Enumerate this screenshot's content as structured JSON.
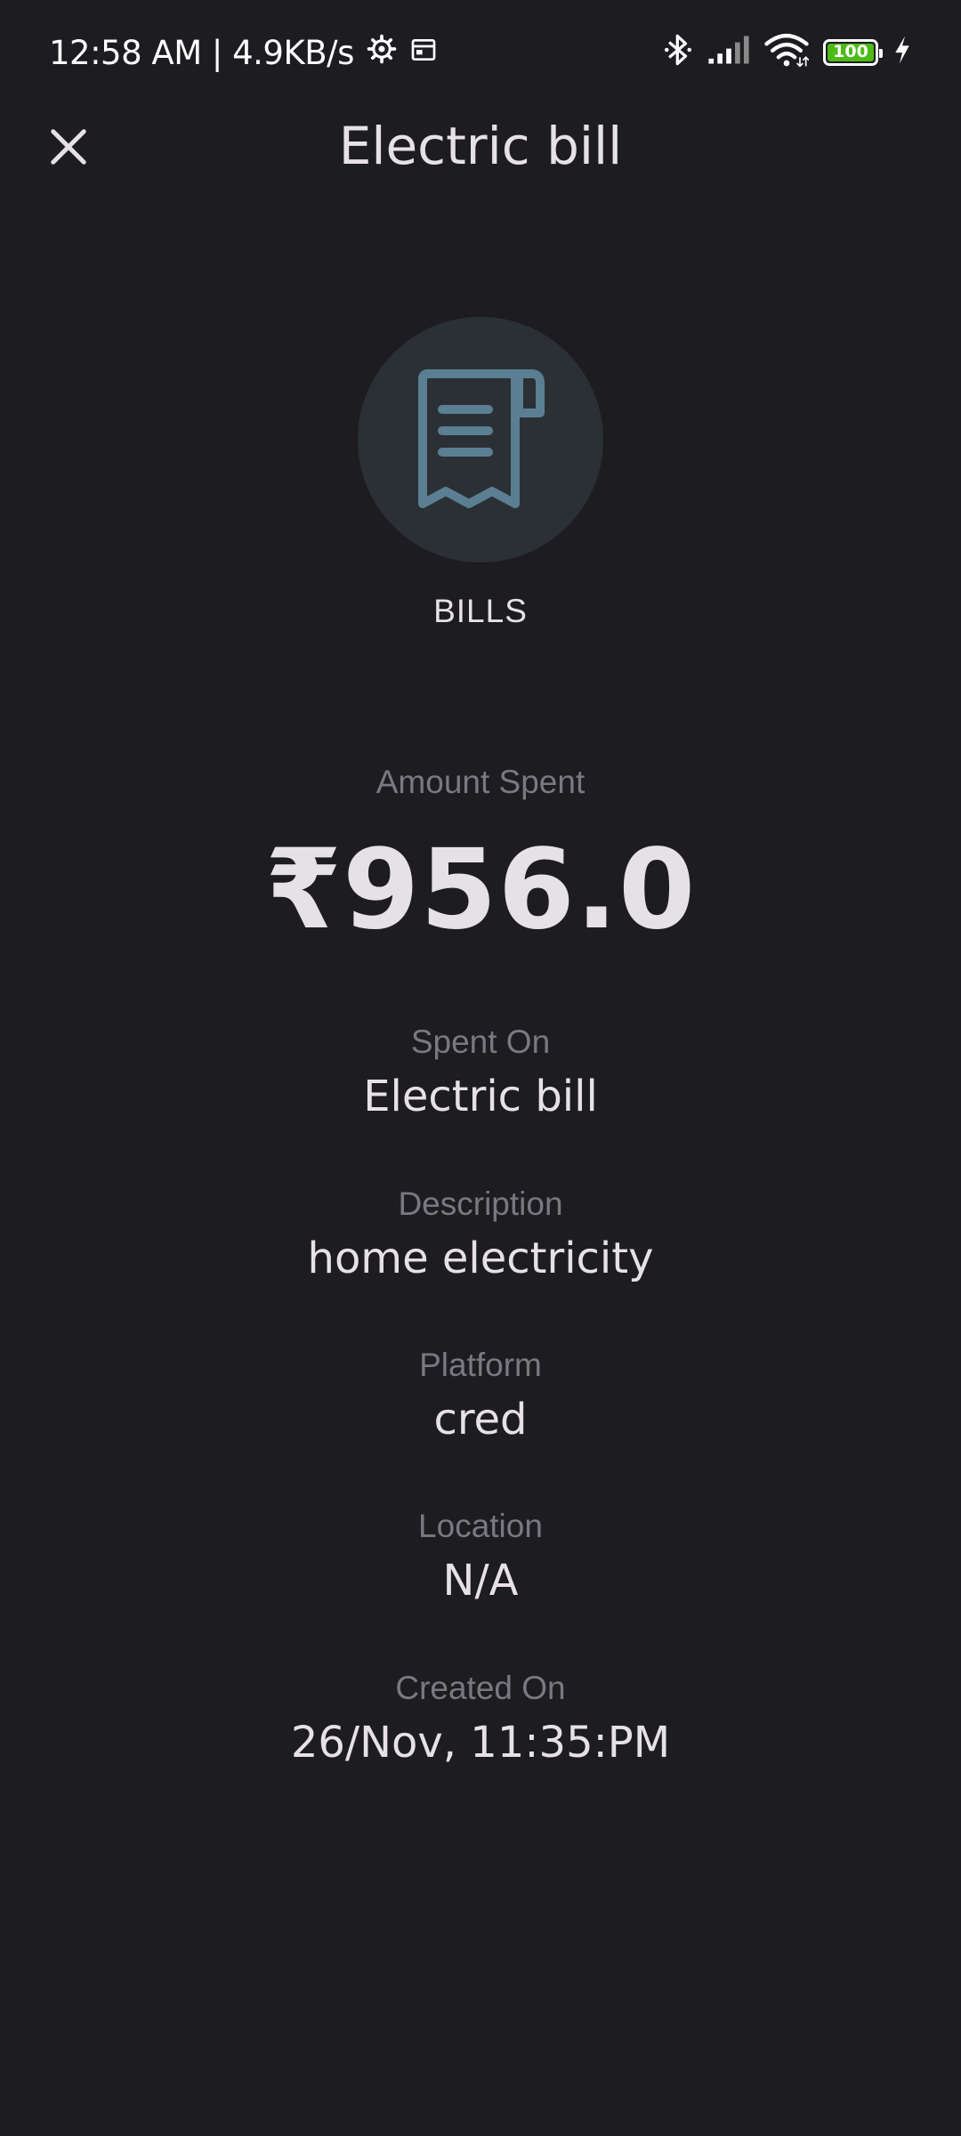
{
  "status_bar": {
    "time_speed": "12:58 AM | 4.9KB/s",
    "battery_level": "100",
    "battery_color": "#4cbb17"
  },
  "app_bar": {
    "close_icon": "close-icon",
    "title": "Electric bill"
  },
  "category": {
    "icon": "receipt-icon",
    "icon_color": "#5b7f92",
    "label": "BILLS"
  },
  "amount": {
    "label": "Amount Spent",
    "value": "₹956.0"
  },
  "details": [
    {
      "label": "Spent On",
      "value": "Electric bill"
    },
    {
      "label": "Description",
      "value": "home electricity"
    },
    {
      "label": "Platform",
      "value": "cred"
    },
    {
      "label": "Location",
      "value": "N/A"
    },
    {
      "label": "Created On",
      "value": "26/Nov, 11:35:PM"
    }
  ]
}
